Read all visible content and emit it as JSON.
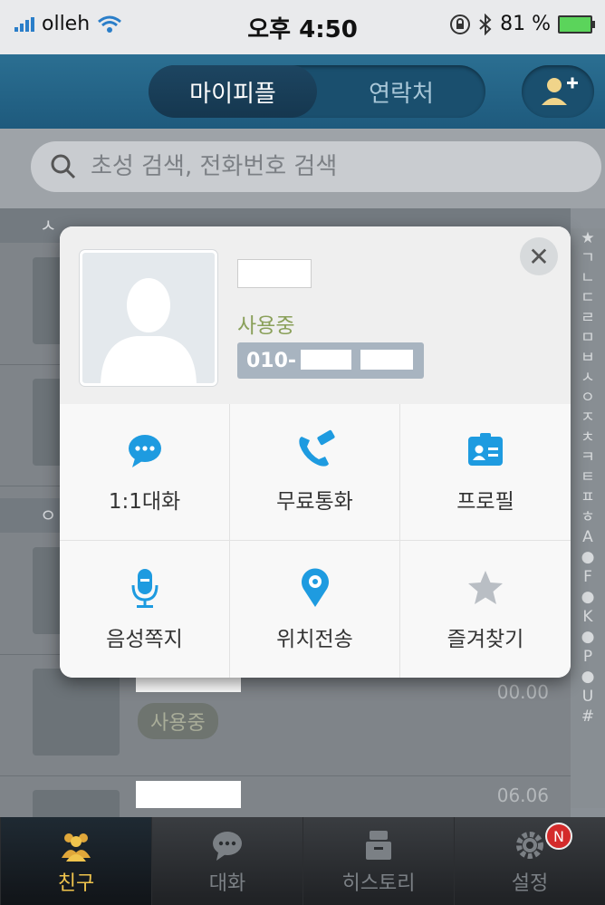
{
  "status_bar": {
    "carrier": "olleh",
    "time": "오후 4:50",
    "battery": "81 %"
  },
  "header": {
    "tabs": [
      {
        "label": "마이피플",
        "active": true
      },
      {
        "label": "연락처",
        "active": false
      }
    ],
    "add_icon": "add-person-icon"
  },
  "search": {
    "placeholder": "초성 검색, 전화번호 검색"
  },
  "list": {
    "sections": [
      "ㅅ",
      "ㅇ"
    ],
    "rows": [
      {
        "status": "사용중",
        "date": "00.00"
      },
      {
        "status": "",
        "date": "06.06"
      }
    ]
  },
  "index": [
    "★",
    "ㄱ",
    "ㄴ",
    "ㄷ",
    "ㄹ",
    "ㅁ",
    "ㅂ",
    "ㅅ",
    "ㅇ",
    "ㅈ",
    "ㅊ",
    "ㅋ",
    "ㅌ",
    "ㅍ",
    "ㅎ",
    "A",
    "●",
    "F",
    "●",
    "K",
    "●",
    "P",
    "●",
    "U",
    "#"
  ],
  "dialog": {
    "status": "사용중",
    "phone_prefix": "010-",
    "actions": [
      {
        "label": "1:1대화",
        "icon": "chat-bubble-icon",
        "color": "#1e9be0"
      },
      {
        "label": "무료통화",
        "icon": "phone-free-icon",
        "color": "#1e9be0"
      },
      {
        "label": "프로필",
        "icon": "profile-card-icon",
        "color": "#1e9be0"
      },
      {
        "label": "음성쪽지",
        "icon": "microphone-icon",
        "color": "#1e9be0"
      },
      {
        "label": "위치전송",
        "icon": "location-pin-icon",
        "color": "#1e9be0"
      },
      {
        "label": "즐겨찾기",
        "icon": "star-icon",
        "color": "#b9bec4"
      }
    ]
  },
  "tabbar": {
    "tabs": [
      {
        "label": "친구",
        "icon": "friends-icon",
        "active": true
      },
      {
        "label": "대화",
        "icon": "chat-icon",
        "active": false
      },
      {
        "label": "히스토리",
        "icon": "history-icon",
        "active": false
      },
      {
        "label": "설정",
        "icon": "gear-icon",
        "active": false,
        "badge": "N"
      }
    ]
  },
  "colors": {
    "header": "#1e5a7d",
    "accent": "#1e9be0",
    "active_tab": "#f0c44d",
    "badge": "#d42b2b"
  }
}
